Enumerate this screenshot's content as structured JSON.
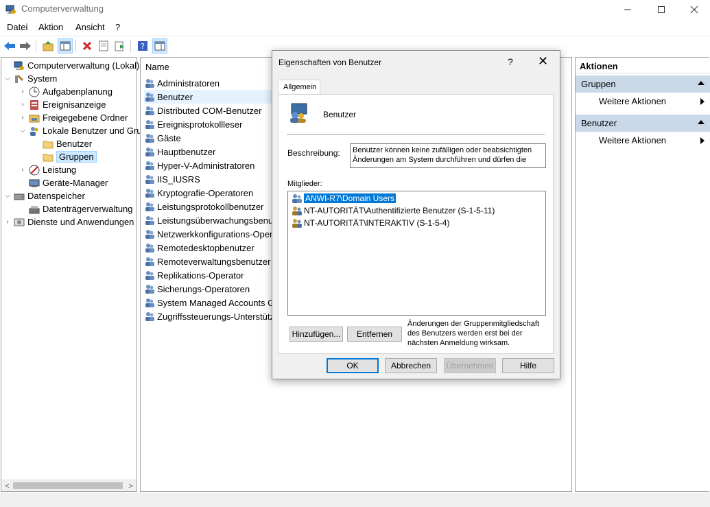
{
  "window": {
    "title": "Computerverwaltung"
  },
  "menu": [
    "Datei",
    "Aktion",
    "Ansicht",
    "?"
  ],
  "tree": [
    {
      "label": "Computerverwaltung (Lokal)",
      "expander": "",
      "icon": "computer-management-icon"
    },
    {
      "label": "System",
      "expander": "⌵",
      "icon": "system-tools-icon"
    },
    {
      "label": "Aufgabenplanung",
      "expander": "›",
      "icon": "task-scheduler-icon"
    },
    {
      "label": "Ereignisanzeige",
      "expander": "›",
      "icon": "event-viewer-icon"
    },
    {
      "label": "Freigegebene Ordner",
      "expander": "›",
      "icon": "shared-folders-icon"
    },
    {
      "label": "Lokale Benutzer und Gruppen",
      "expander": "⌵",
      "icon": "local-users-icon"
    },
    {
      "label": "Benutzer",
      "expander": "",
      "icon": "folder-icon"
    },
    {
      "label": "Gruppen",
      "expander": "",
      "icon": "folder-icon",
      "selected": true
    },
    {
      "label": "Leistung",
      "expander": "›",
      "icon": "performance-icon"
    },
    {
      "label": "Geräte-Manager",
      "expander": "",
      "icon": "device-manager-icon"
    },
    {
      "label": "Datenspeicher",
      "expander": "⌵",
      "icon": "storage-icon"
    },
    {
      "label": "Datenträgerverwaltung",
      "expander": "",
      "icon": "disk-management-icon"
    },
    {
      "label": "Dienste und Anwendungen",
      "expander": "›",
      "icon": "services-icon"
    }
  ],
  "list": {
    "header": "Name",
    "items": [
      "Administratoren",
      "Benutzer",
      "Distributed COM-Benutzer",
      "Ereignisprotokollleser",
      "Gäste",
      "Hauptbenutzer",
      "Hyper-V-Administratoren",
      "IIS_IUSRS",
      "Kryptografie-Operatoren",
      "Leistungsprotokollbenutzer",
      "Leistungsüberwachungsbenutzer",
      "Netzwerkkonfigurations-Operatoren",
      "Remotedesktopbenutzer",
      "Remoteverwaltungsbenutzer",
      "Replikations-Operator",
      "Sicherungs-Operatoren",
      "System Managed Accounts Group",
      "Zugriffssteuerungs-Unterstützungsoperatoren"
    ],
    "selected_index": 1
  },
  "actions": {
    "title": "Aktionen",
    "sections": [
      {
        "label": "Gruppen",
        "item": "Weitere Aktionen"
      },
      {
        "label": "Benutzer",
        "item": "Weitere Aktionen"
      }
    ]
  },
  "dialog": {
    "title": "Eigenschaften von Benutzer",
    "help": "?",
    "close": "✕",
    "tab": "Allgemein",
    "group_name": "Benutzer",
    "description_label": "Beschreibung:",
    "description": "Benutzer können keine zufälligen oder beabsichtigten Änderungen am System durchführen und dürfen die",
    "members_label": "Mitglieder:",
    "members": [
      "ANWI-R7\\Domain Users",
      "NT-AUTORITÄT\\Authentifizierte Benutzer (S-1-5-11)",
      "NT-AUTORITÄT\\INTERAKTIV (S-1-5-4)"
    ],
    "selected_member": 0,
    "add_button": "Hinzufügen...",
    "remove_button": "Entfernen",
    "note": "Änderungen der Gruppenmitgliedschaft des Benutzers werden erst bei der nächsten Anmeldung wirksam.",
    "ok_button": "OK",
    "cancel_button": "Abbrechen",
    "apply_button": "Übernehmen",
    "help_button": "Hilfe"
  }
}
